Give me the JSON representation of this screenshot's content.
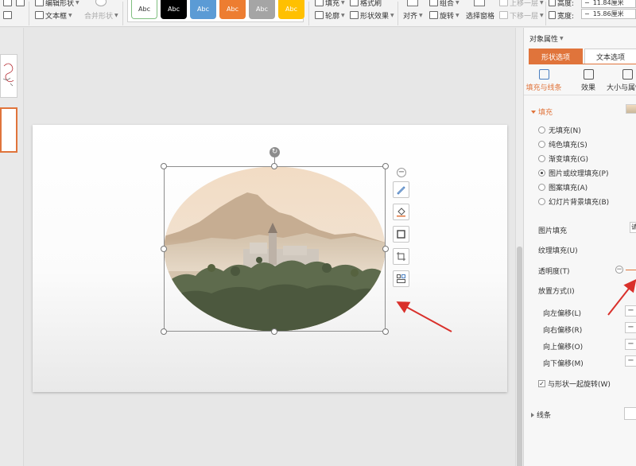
{
  "ribbon": {
    "edit_shape_label": "编辑形状",
    "textbox_label": "文本框",
    "merge_shape_label": "合并形状",
    "style_samples": [
      {
        "label": "Abc",
        "bg": "#ffffff",
        "fg": "#333333",
        "border": "#7fbf7f"
      },
      {
        "label": "Abc",
        "bg": "#000000",
        "fg": "#ffffff",
        "border": "#000000"
      },
      {
        "label": "Abc",
        "bg": "#5b9bd5",
        "fg": "#ffffff",
        "border": "#5b9bd5"
      },
      {
        "label": "Abc",
        "bg": "#ed7d31",
        "fg": "#ffffff",
        "border": "#ed7d31"
      },
      {
        "label": "Abc",
        "bg": "#a5a5a5",
        "fg": "#ffffff",
        "border": "#a5a5a5"
      },
      {
        "label": "Abc",
        "bg": "#ffc000",
        "fg": "#ffffff",
        "border": "#ffc000"
      }
    ],
    "fill_label": "填充",
    "format_painter_label": "格式刷",
    "outline_label": "轮廓",
    "shape_effects_label": "形状效果",
    "align_label": "对齐",
    "group_label": "组合",
    "rotate_label": "旋转",
    "selection_pane_label": "选择窗格",
    "bring_forward_label": "上移一层",
    "send_backward_label": "下移一层",
    "height_label": "高度:",
    "height_value": "11.84厘米",
    "width_label": "宽度:",
    "width_value": "15.86厘米"
  },
  "thumbnails": {
    "numbers": [
      "",
      ""
    ]
  },
  "panel": {
    "title": "对象属性",
    "tab_shape": "形状选项",
    "tab_text": "文本选项",
    "sub_fill_line": "填充与线条",
    "sub_effects": "效果",
    "sub_size": "大小与属性",
    "fill_section": "填充",
    "fill_options": [
      "无填充(N)",
      "纯色填充(S)",
      "渐变填充(G)",
      "图片或纹理填充(P)",
      "图案填充(A)",
      "幻灯片背景填充(B)"
    ],
    "selected_fill_index": 3,
    "picture_fill_label": "图片填充",
    "picture_fill_value": "请",
    "texture_fill_label": "纹理填充(U)",
    "transparency_label": "透明度(T)",
    "placement_label": "放置方式(I)",
    "offsets": [
      "向左偏移(L)",
      "向右偏移(R)",
      "向上偏移(O)",
      "向下偏移(M)"
    ],
    "rotate_with_shape_label": "与形状一起旋转(W)",
    "rotate_with_shape_checked": "✓",
    "line_section": "线条"
  },
  "colors": {
    "accent": "#e0743b",
    "arrow": "#d9302b",
    "selection_blue": "#4a7fc1"
  }
}
